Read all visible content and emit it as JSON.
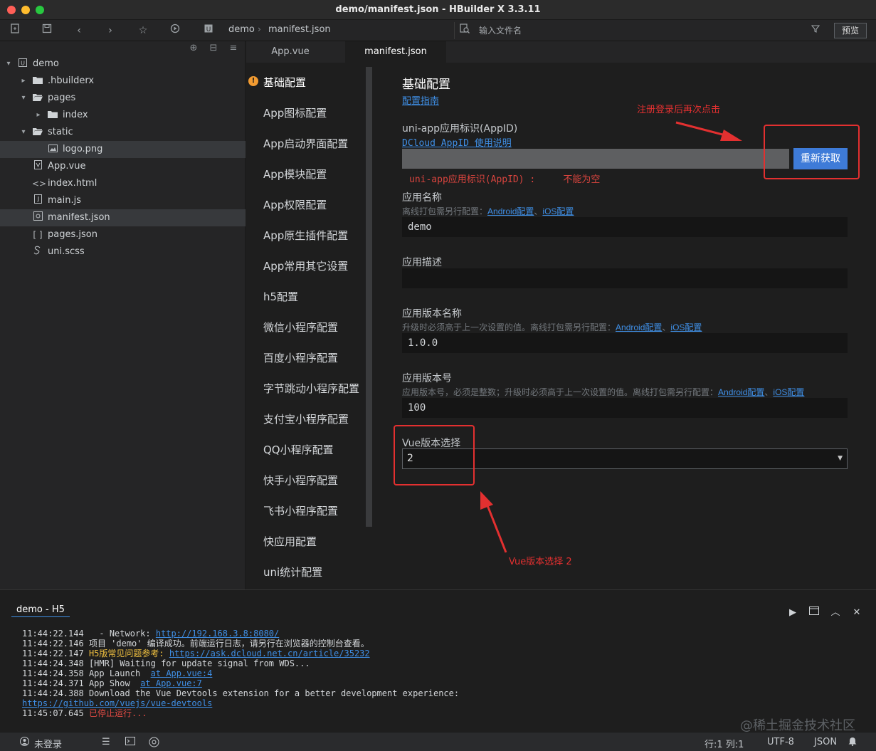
{
  "window": {
    "title": "demo/manifest.json - HBuilder X 3.3.11"
  },
  "toolbar": {
    "breadcrumb": [
      "demo",
      "manifest.json"
    ],
    "search_placeholder": "输入文件名",
    "preview_label": "预览"
  },
  "sidebar": {
    "tree": [
      {
        "label": "demo",
        "icon": "project-icon",
        "arrow": "▾"
      },
      {
        "label": ".hbuilderx",
        "icon": "folder-icon",
        "arrow": "▸"
      },
      {
        "label": "pages",
        "icon": "folder-open-icon",
        "arrow": "▾"
      },
      {
        "label": "index",
        "icon": "folder-icon",
        "arrow": "▸"
      },
      {
        "label": "static",
        "icon": "folder-open-icon",
        "arrow": "▾"
      },
      {
        "label": "logo.png",
        "icon": "image-icon"
      },
      {
        "label": "App.vue",
        "icon": "vue-file-icon"
      },
      {
        "label": "index.html",
        "icon": "html-file-icon"
      },
      {
        "label": "main.js",
        "icon": "js-file-icon"
      },
      {
        "label": "manifest.json",
        "icon": "json-file-icon"
      },
      {
        "label": "pages.json",
        "icon": "brackets-icon"
      },
      {
        "label": "uni.scss",
        "icon": "scss-file-icon"
      }
    ]
  },
  "tabs": [
    {
      "label": "App.vue",
      "active": false
    },
    {
      "label": "manifest.json",
      "active": true
    }
  ],
  "settings_nav": [
    "基础配置",
    "App图标配置",
    "App启动界面配置",
    "App模块配置",
    "App权限配置",
    "App原生插件配置",
    "App常用其它设置",
    "h5配置",
    "微信小程序配置",
    "百度小程序配置",
    "字节跳动小程序配置",
    "支付宝小程序配置",
    "QQ小程序配置",
    "快手小程序配置",
    "飞书小程序配置",
    "快应用配置",
    "uni统计配置"
  ],
  "form": {
    "title": "基础配置",
    "guide_link": "配置指南",
    "appid": {
      "label": "uni-app应用标识(AppID)",
      "link": "DCloud AppID 使用说明",
      "value": "",
      "button": "重新获取",
      "error": "uni-app应用标识(AppID) :     不能为空"
    },
    "app_name": {
      "label": "应用名称",
      "hint": "离线打包需另行配置：",
      "android_link": "Android配置",
      "sep": "、",
      "ios_link": "iOS配置",
      "value": "demo"
    },
    "app_desc": {
      "label": "应用描述",
      "value": ""
    },
    "version_name": {
      "label": "应用版本名称",
      "hint": "升级时必须高于上一次设置的值。离线打包需另行配置：",
      "android_link": "Android配置",
      "sep": "、",
      "ios_link": "iOS配置",
      "value": "1.0.0"
    },
    "version_code": {
      "label": "应用版本号",
      "hint": "应用版本号，必须是整数；升级时必须高于上一次设置的值。离线打包需另行配置：",
      "android_link": "Android配置",
      "sep": "、",
      "ios_link": "iOS配置",
      "value": "100"
    },
    "vue_version": {
      "label": "Vue版本选择",
      "value": "2"
    }
  },
  "annotations": {
    "top": "注册登录后再次点击",
    "bottom": "Vue版本选择 2",
    "color": "#e33030"
  },
  "console": {
    "tab": "demo - H5",
    "lines": [
      {
        "time": "11:44:22.144",
        "text": "  - Network: ",
        "link": "http://192.168.3.8:8080/"
      },
      {
        "time": "11:44:22.146",
        "text": "项目 'demo' 编译成功。前端运行日志，请另行在浏览器的控制台查看。"
      },
      {
        "time": "11:44:22.147",
        "yellow": "H5版常见问题参考:",
        "link": "https://ask.dcloud.net.cn/article/35232"
      },
      {
        "time": "11:44:24.348",
        "text": "[HMR] Waiting for update signal from WDS..."
      },
      {
        "time": "11:44:24.358",
        "text": "App Launch  ",
        "link": "at App.vue:4"
      },
      {
        "time": "11:44:24.371",
        "text": "App Show  ",
        "link": "at App.vue:7"
      },
      {
        "time": "11:44:24.388",
        "text": "Download the Vue Devtools extension for a better development experience:"
      },
      {
        "link": "https://github.com/vuejs/vue-devtools"
      },
      {
        "time": "11:45:07.645",
        "red": "已停止运行..."
      }
    ],
    "watermark": "@稀土掘金技术社区"
  },
  "status": {
    "login": "未登录",
    "position": "行:1  列:1",
    "encoding": "UTF-8",
    "language": "JSON"
  },
  "colors": {
    "accent": "#3e7bd8",
    "link": "#3f8fe6",
    "error": "#d9443e",
    "warning": "#f29b31"
  }
}
